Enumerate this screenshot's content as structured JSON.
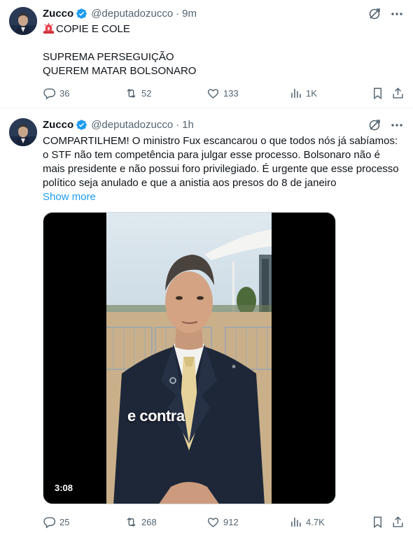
{
  "colors": {
    "accent": "#1d9bf0",
    "text": "#0f1419",
    "secondary": "#536471",
    "verified": "#1d9bf0"
  },
  "tweets": [
    {
      "author": {
        "name": "Zucco",
        "handle": "@deputadozucco",
        "verified": true
      },
      "time": "9m",
      "header_icons": [
        "grok-icon",
        "more-icon"
      ],
      "lines": [
        "COPIE E COLE",
        "",
        "SUPREMA PERSEGUIÇÃO",
        "QUEREM MATAR BOLSONARO"
      ],
      "lead_icon": "siren-icon",
      "actions": {
        "replies": "36",
        "reposts": "52",
        "likes": "133",
        "views": "1K"
      }
    },
    {
      "author": {
        "name": "Zucco",
        "handle": "@deputadozucco",
        "verified": true
      },
      "time": "1h",
      "header_icons": [
        "grok-icon",
        "more-icon"
      ],
      "lines": [
        "COMPARTILHEM! O ministro Fux escancarou o que todos nós já sabíamos:",
        "o STF não tem competência para julgar esse processo. Bolsonaro não é",
        "mais presidente e não possui foro privilegiado. É urgente que esse processo",
        "político seja anulado e que a anistia aos presos do 8 de janeiro"
      ],
      "show_more": "Show more",
      "media": {
        "caption": "e contra",
        "duration": "3:08"
      },
      "actions": {
        "replies": "25",
        "reposts": "268",
        "likes": "912",
        "views": "4.7K"
      }
    }
  ]
}
